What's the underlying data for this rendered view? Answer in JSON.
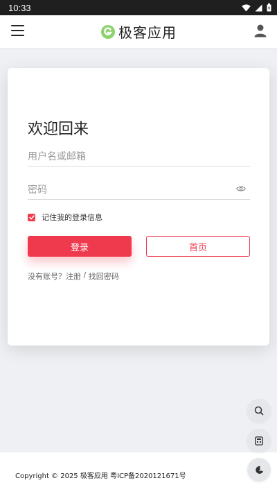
{
  "status_bar": {
    "time": "10:33"
  },
  "header": {
    "logo_text": "极客应用"
  },
  "login_card": {
    "title": "欢迎回来",
    "username_placeholder": "用户名或邮箱",
    "password_placeholder": "密码",
    "remember_label": "记住我的登录信息",
    "remember_checked": true,
    "login_button": "登录",
    "home_button": "首页",
    "no_account_text": "没有账号？",
    "register_link": "注册",
    "separator": " / ",
    "forgot_link": "找回密码"
  },
  "footer": {
    "copyright": "Copyright © 2025 极客应用 粤ICP备2020121671号"
  },
  "colors": {
    "accent": "#ef3a4d",
    "logo_green": "#8ed16e",
    "status_bar": "#1f1f1f"
  },
  "icons": [
    "menu-icon",
    "logo-icon",
    "user-icon",
    "eye-icon",
    "check-icon",
    "search-icon",
    "calculator-icon",
    "theme-moon-icon",
    "wifi-icon",
    "signal-icon",
    "battery-icon"
  ]
}
